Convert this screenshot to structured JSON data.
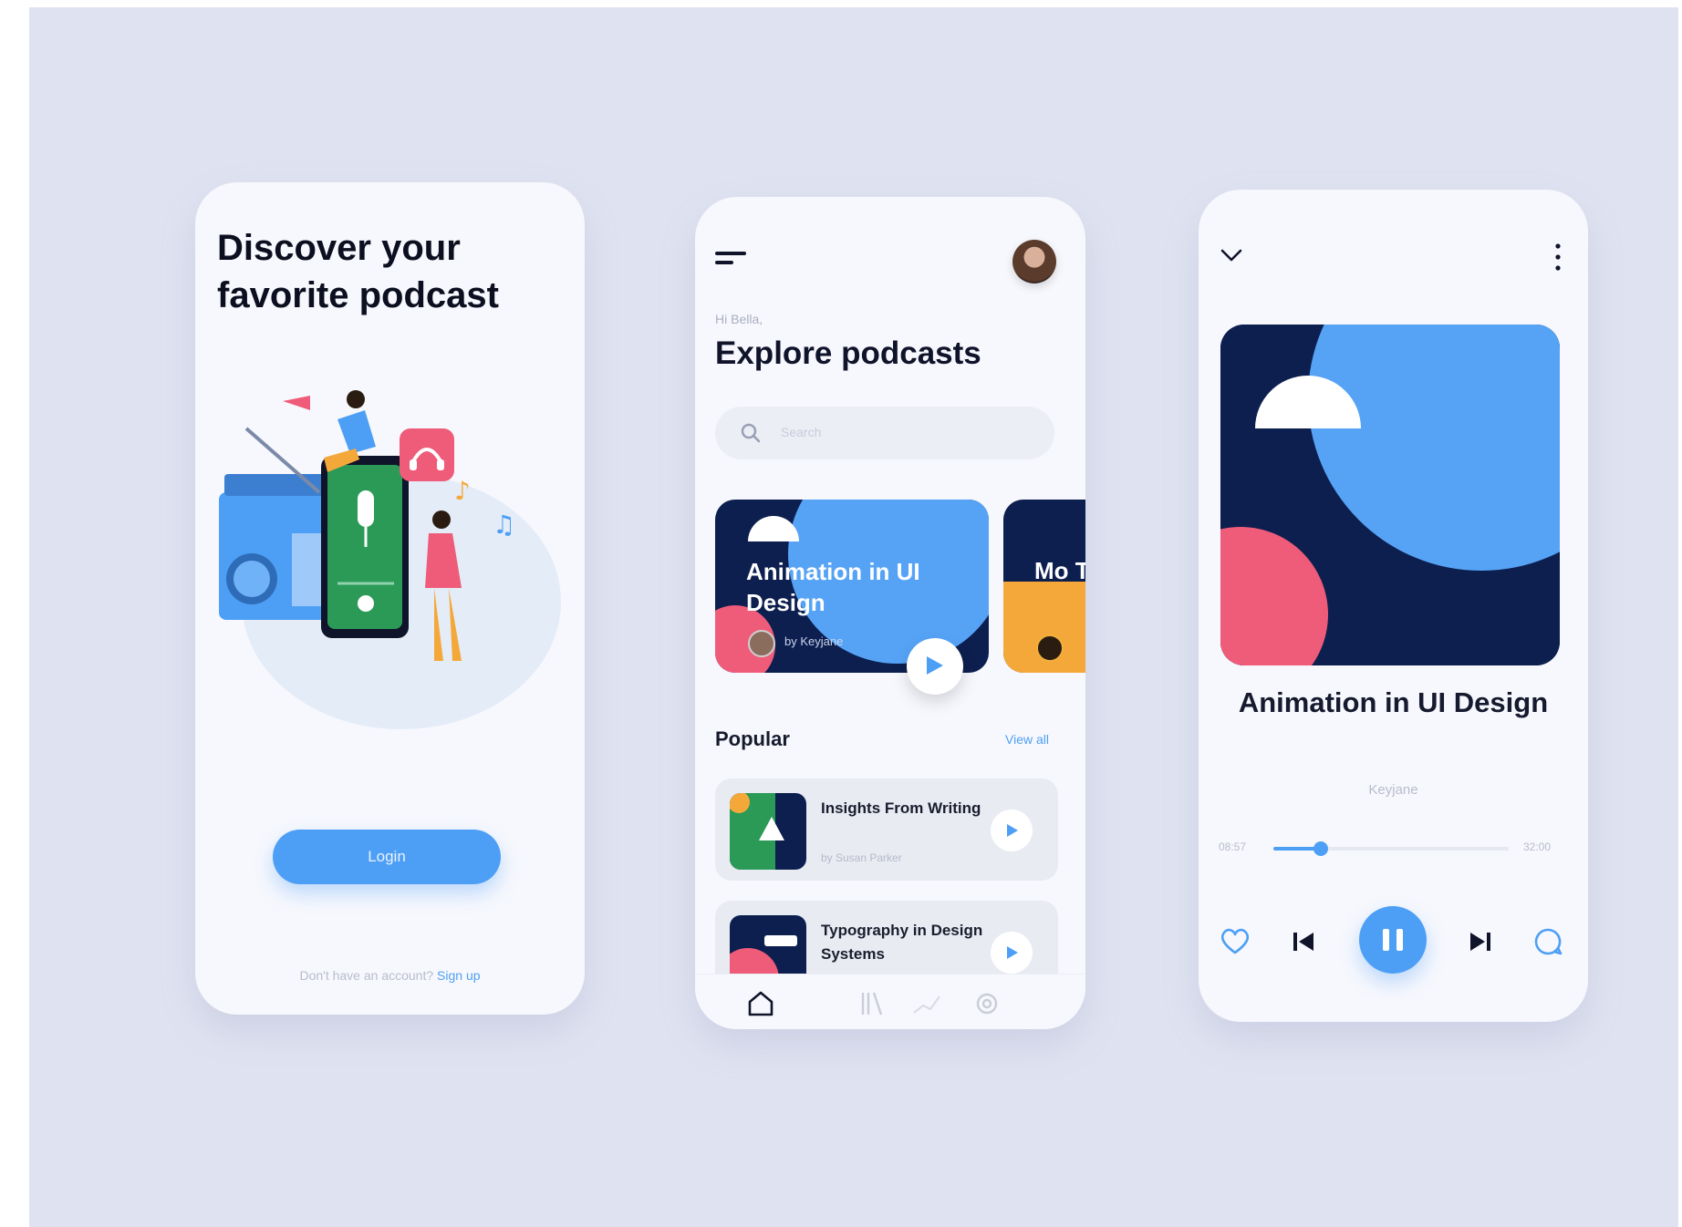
{
  "onboarding": {
    "title": "Discover your favorite podcast",
    "login_label": "Login",
    "signup_prompt": "Don't have an account?",
    "signup_link": "Sign up"
  },
  "explore": {
    "greeting": "Hi Bella,",
    "title": "Explore podcasts",
    "search_placeholder": "Search",
    "featured": [
      {
        "title": "Animation in UI Design",
        "author": "by Keyjane"
      },
      {
        "title": "Mo Tre",
        "author": ""
      }
    ],
    "popular_label": "Popular",
    "view_all_label": "View all",
    "list": [
      {
        "title": "Insights From Writing",
        "author": "by Susan Parker"
      },
      {
        "title": "Typography in Design Systems",
        "author": ""
      }
    ],
    "tabs": [
      "home-icon",
      "library-icon",
      "stats-icon",
      "settings-icon"
    ]
  },
  "player": {
    "title": "Animation in UI Design",
    "author": "Keyjane",
    "time_elapsed": "08:57",
    "time_total": "32:00",
    "progress": 0.2
  },
  "colors": {
    "accent": "#4d9ff5",
    "navy": "#0d1f4f",
    "sky": "#56a3f6",
    "coral": "#ef5c7a",
    "amber": "#f5a83a",
    "green": "#2a9a56",
    "background": "#dfe3f1"
  }
}
